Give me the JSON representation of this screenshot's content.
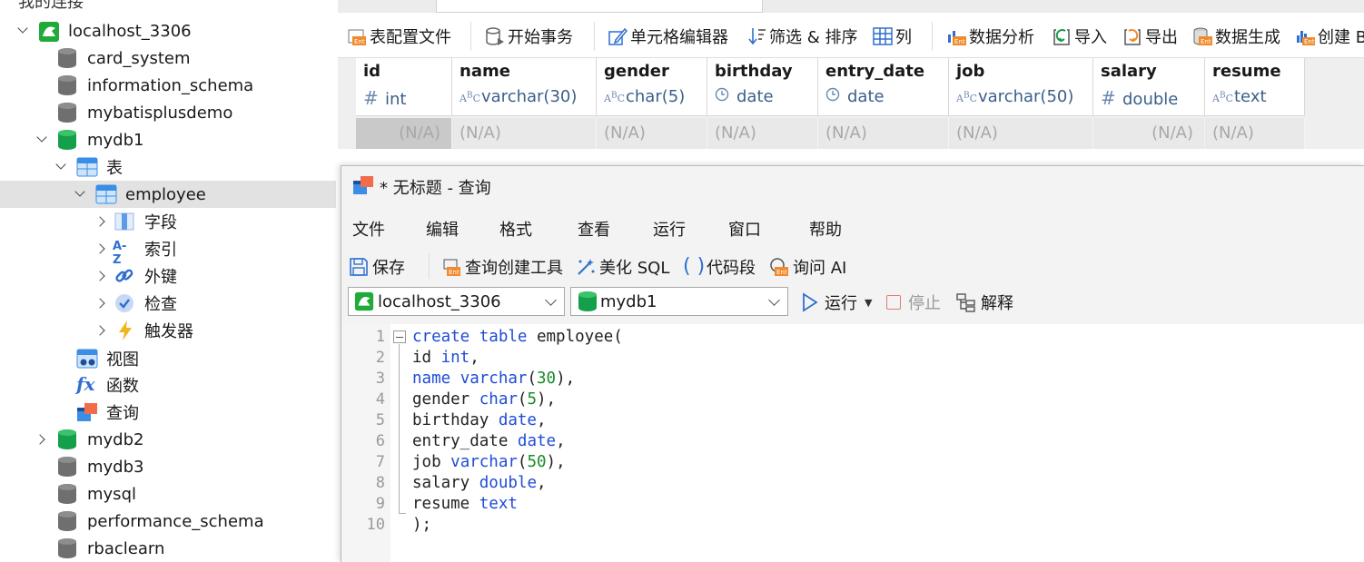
{
  "navigator": {
    "clipped_label": "我的连接",
    "items": [
      {
        "label": "localhost_3306",
        "icon": "mysql-connection-icon"
      },
      {
        "label": "card_system",
        "icon": "database-icon"
      },
      {
        "label": "information_schema",
        "icon": "database-icon"
      },
      {
        "label": "mybatisplusdemo",
        "icon": "database-icon"
      },
      {
        "label": "mydb1",
        "icon": "database-open-icon"
      },
      {
        "label": "表",
        "icon": "tables-icon"
      },
      {
        "label": "employee",
        "icon": "table-icon"
      },
      {
        "label": "字段",
        "icon": "fields-icon"
      },
      {
        "label": "索引",
        "icon": "index-icon"
      },
      {
        "label": "外键",
        "icon": "foreign-key-icon"
      },
      {
        "label": "检查",
        "icon": "check-icon"
      },
      {
        "label": "触发器",
        "icon": "trigger-icon"
      },
      {
        "label": "视图",
        "icon": "view-icon"
      },
      {
        "label": "函数",
        "icon": "function-icon"
      },
      {
        "label": "查询",
        "icon": "query-icon"
      },
      {
        "label": "mydb2",
        "icon": "database-open-icon"
      },
      {
        "label": "mydb3",
        "icon": "database-icon"
      },
      {
        "label": "mysql",
        "icon": "database-icon"
      },
      {
        "label": "performance_schema",
        "icon": "database-icon"
      },
      {
        "label": "rbaclearn",
        "icon": "database-icon"
      }
    ]
  },
  "toolbar": {
    "items": [
      {
        "label": "表配置文件",
        "icon": "table-profile-icon"
      },
      {
        "label": "开始事务",
        "icon": "begin-transaction-icon"
      },
      {
        "label": "单元格编辑器",
        "icon": "cell-editor-icon"
      },
      {
        "label": "筛选 & 排序",
        "icon": "filter-sort-icon"
      },
      {
        "label": "列",
        "icon": "columns-icon"
      },
      {
        "label": "数据分析",
        "icon": "data-analysis-icon"
      },
      {
        "label": "导入",
        "icon": "import-icon"
      },
      {
        "label": "导出",
        "icon": "export-icon"
      },
      {
        "label": "数据生成",
        "icon": "data-generation-icon"
      },
      {
        "label": "创建 B",
        "icon": "create-chart-icon"
      }
    ]
  },
  "grid": {
    "columns": [
      {
        "name": "id",
        "type": "int",
        "type_glyph": "#"
      },
      {
        "name": "name",
        "type": "varchar(30)",
        "type_glyph": "ABC"
      },
      {
        "name": "gender",
        "type": "char(5)",
        "type_glyph": "ABC"
      },
      {
        "name": "birthday",
        "type": "date",
        "type_glyph": "clock"
      },
      {
        "name": "entry_date",
        "type": "date",
        "type_glyph": "clock"
      },
      {
        "name": "job",
        "type": "varchar(50)",
        "type_glyph": "ABC"
      },
      {
        "name": "salary",
        "type": "double",
        "type_glyph": "#"
      },
      {
        "name": "resume",
        "type": "text",
        "type_glyph": "ABC"
      }
    ],
    "row": [
      "(N/A)",
      "(N/A)",
      "(N/A)",
      "(N/A)",
      "(N/A)",
      "(N/A)",
      "(N/A)",
      "(N/A)"
    ]
  },
  "query_window": {
    "title": "* 无标题 - 查询",
    "menu": [
      "文件",
      "编辑",
      "格式",
      "查看",
      "运行",
      "窗口",
      "帮助"
    ],
    "tools": [
      {
        "label": "保存",
        "icon": "save-icon"
      },
      {
        "label": "查询创建工具",
        "icon": "query-builder-icon"
      },
      {
        "label": "美化 SQL",
        "icon": "beautify-sql-icon"
      },
      {
        "label": "代码段",
        "icon": "code-snippet-icon"
      },
      {
        "label": "询问 AI",
        "icon": "ask-ai-icon"
      }
    ],
    "connection": "localhost_3306",
    "database": "mydb1",
    "run_label": "运行",
    "stop_label": "停止",
    "explain_label": "解释",
    "code": [
      [
        {
          "t": "create",
          "k": "kw"
        },
        {
          "t": " ",
          "k": ""
        },
        {
          "t": "table",
          "k": "kw"
        },
        {
          "t": " employee(",
          "k": ""
        }
      ],
      [
        {
          "t": "id ",
          "k": ""
        },
        {
          "t": "int",
          "k": "kw"
        },
        {
          "t": ",",
          "k": ""
        }
      ],
      [
        {
          "t": "name",
          "k": "kw"
        },
        {
          "t": " ",
          "k": ""
        },
        {
          "t": "varchar",
          "k": "kw"
        },
        {
          "t": "(",
          "k": ""
        },
        {
          "t": "30",
          "k": "num"
        },
        {
          "t": "),",
          "k": ""
        }
      ],
      [
        {
          "t": "gender ",
          "k": ""
        },
        {
          "t": "char",
          "k": "kw"
        },
        {
          "t": "(",
          "k": ""
        },
        {
          "t": "5",
          "k": "num"
        },
        {
          "t": "),",
          "k": ""
        }
      ],
      [
        {
          "t": "birthday ",
          "k": ""
        },
        {
          "t": "date",
          "k": "kw"
        },
        {
          "t": ",",
          "k": ""
        }
      ],
      [
        {
          "t": "entry_date ",
          "k": ""
        },
        {
          "t": "date",
          "k": "kw"
        },
        {
          "t": ",",
          "k": ""
        }
      ],
      [
        {
          "t": "job ",
          "k": ""
        },
        {
          "t": "varchar",
          "k": "kw"
        },
        {
          "t": "(",
          "k": ""
        },
        {
          "t": "50",
          "k": "num"
        },
        {
          "t": "),",
          "k": ""
        }
      ],
      [
        {
          "t": "salary ",
          "k": ""
        },
        {
          "t": "double",
          "k": "kw"
        },
        {
          "t": ",",
          "k": ""
        }
      ],
      [
        {
          "t": "resume ",
          "k": ""
        },
        {
          "t": "text",
          "k": "kw"
        }
      ],
      [
        {
          "t": ");",
          "k": ""
        }
      ]
    ],
    "line_numbers": [
      "1",
      "2",
      "3",
      "4",
      "5",
      "6",
      "7",
      "8",
      "9",
      "10"
    ]
  },
  "colors": {
    "keyword": "#1f4bd6",
    "number": "#1a8c28",
    "selection": "#e2e2e2"
  }
}
